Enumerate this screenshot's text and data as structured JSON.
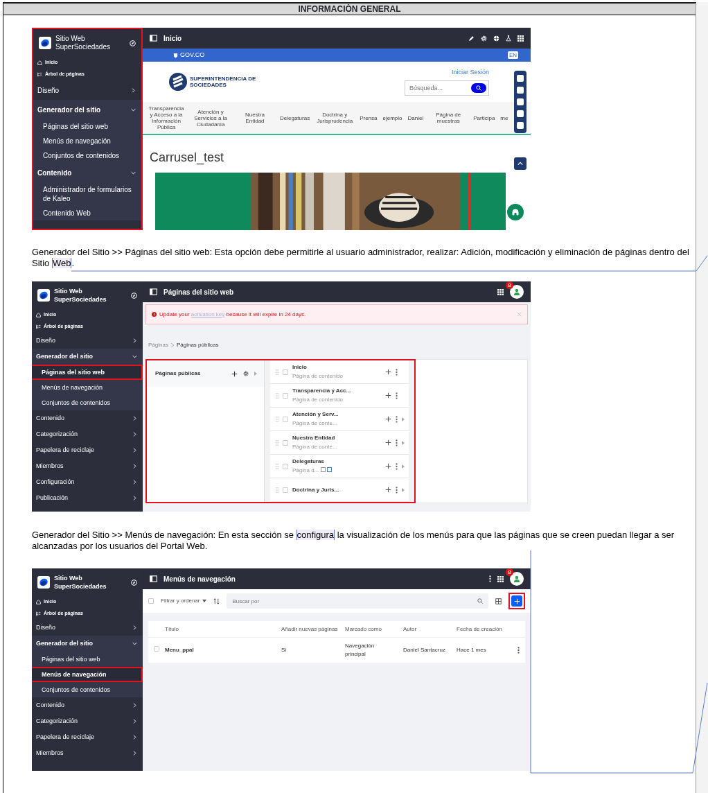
{
  "header": {
    "title": "INFORMACIÓN GENERAL"
  },
  "blocks": [
    {
      "kind": "site_preview",
      "sidebar_outlined": true,
      "sidebar": {
        "site_name": "Sitio Web SuperSociedades",
        "quick_links": [
          "Inicio",
          "Árbol de páginas"
        ],
        "sections": [
          {
            "label": "Diseño",
            "expanded": false
          },
          {
            "label": "Generador del sitio",
            "expanded": true,
            "children": [
              {
                "label": "Páginas del sitio web",
                "selected": false
              },
              {
                "label": "Menús de navegación",
                "selected": false
              },
              {
                "label": "Conjuntos de contenidos",
                "selected": false
              }
            ]
          },
          {
            "label": "Contenido",
            "expanded": true,
            "children": [
              {
                "label": "Administrador de formularios de Kaleo",
                "selected": false
              },
              {
                "label": "Contenido Web",
                "selected": false
              }
            ]
          }
        ]
      },
      "main": {
        "title": "Inicio",
        "gov_label": "GOV.CO",
        "lang_badge": "EN",
        "brand": "SUPERINTENDENCIA DE SOCIEDADES",
        "login_link": "Iniciar Sesión",
        "search_placeholder": "Búsqueda...",
        "nav": [
          "Transparencia y Acceso a la Información Pública",
          "Atención y Servicios a la Ciudadanía",
          "Nuestra Entidad",
          "Delegaturas",
          "Doctrina y Jurisprudencia",
          "Prensa",
          "ejemplo",
          "Daniel",
          "Página de muestras",
          "Participa",
          "me"
        ],
        "heading": "Carrusel_test"
      }
    },
    {
      "kind": "paragraph",
      "before": "Generador del Sitio >> Páginas del sitio web: Esta opción debe permitirle al usuario administrador, realizar: Adición, modificación y eliminación de páginas dentro del Sitio ",
      "anchor": "Web",
      "after": "."
    },
    {
      "kind": "pages_admin",
      "sidebar_outlined": false,
      "sidebar": {
        "site_name": "Sitio Web SuperSociedades",
        "quick_links": [
          "Inicio",
          "Árbol de páginas"
        ],
        "sections": [
          {
            "label": "Diseño",
            "expanded": false
          },
          {
            "label": "Generador del sitio",
            "expanded": true,
            "children": [
              {
                "label": "Páginas del sitio web",
                "selected": true
              },
              {
                "label": "Menús de navegación",
                "selected": false
              },
              {
                "label": "Conjuntos de contenidos",
                "selected": false
              }
            ]
          },
          {
            "label": "Contenido",
            "expanded": false
          },
          {
            "label": "Categorización",
            "expanded": false
          },
          {
            "label": "Papelera de reciclaje",
            "expanded": false
          },
          {
            "label": "Miembros",
            "expanded": false
          },
          {
            "label": "Configuración",
            "expanded": false
          },
          {
            "label": "Publicación",
            "expanded": false
          }
        ]
      },
      "main": {
        "title": "Páginas del sitio web",
        "notification_count": "8",
        "alert": {
          "before": "Update your",
          "link": "activation key",
          "after": "because it will expire in 24 days."
        },
        "breadcrumb": [
          "Páginas",
          "Páginas públicas"
        ],
        "panel_highlighted": true,
        "tree_root": "Páginas públicas",
        "pages": [
          {
            "title": "Inicio",
            "subtitle": "Página de contenido",
            "has_children": false,
            "has_status_icons": false,
            "checked": false
          },
          {
            "title": "Transparencia y Acc...",
            "subtitle": "Página de contenido",
            "has_children": false,
            "has_status_icons": false,
            "checked": false
          },
          {
            "title": "Atención y Serv...",
            "subtitle": "Página de conte...",
            "has_children": true,
            "has_status_icons": false,
            "checked": false
          },
          {
            "title": "Nuestra Entidad",
            "subtitle": "Página de conte...",
            "has_children": true,
            "has_status_icons": false,
            "checked": false
          },
          {
            "title": "Delegaturas",
            "subtitle": "Página d...",
            "has_children": true,
            "has_status_icons": true,
            "checked": false
          },
          {
            "title": "Doctrina y Juris...",
            "has_children": true,
            "has_status_icons": false,
            "checked": false
          }
        ]
      }
    },
    {
      "kind": "paragraph",
      "before": "Generador del Sitio >> Menús de navegación: En esta sección se ",
      "anchor": "configura",
      "after": " la visualización de los menús para que las páginas que se creen puedan llegar a ser alcanzadas por los usuarios del Portal Web."
    },
    {
      "kind": "menus_admin",
      "sidebar_outlined": false,
      "sidebar": {
        "site_name": "Sitio Web SuperSociedades",
        "quick_links": [
          "Inicio",
          "Árbol de páginas"
        ],
        "sections": [
          {
            "label": "Diseño",
            "expanded": false
          },
          {
            "label": "Generador del sitio",
            "expanded": true,
            "children": [
              {
                "label": "Páginas del sitio web",
                "selected": false
              },
              {
                "label": "Menús de navegación",
                "selected": true
              },
              {
                "label": "Conjuntos de contenidos",
                "selected": false
              }
            ]
          },
          {
            "label": "Contenido",
            "expanded": false
          },
          {
            "label": "Categorización",
            "expanded": false
          },
          {
            "label": "Papelera de reciclaje",
            "expanded": false
          },
          {
            "label": "Miembros",
            "expanded": false
          }
        ]
      },
      "main": {
        "title": "Menús de navegación",
        "notification_count": "8",
        "filter_label": "Filtrar y ordenar",
        "select_all_checked": false,
        "search_placeholder": "Buscar por",
        "add_highlighted": true,
        "table": {
          "columns": [
            "Título",
            "Añadir nuevas páginas",
            "Marcado como",
            "Autor",
            "Fecha de creación"
          ],
          "rows": [
            {
              "cells": [
                "Menu_ppal",
                "Sí",
                "Navegación principal",
                "Daniel Santacruz",
                "Hace 1 mes"
              ],
              "selected": false
            }
          ]
        }
      }
    }
  ]
}
